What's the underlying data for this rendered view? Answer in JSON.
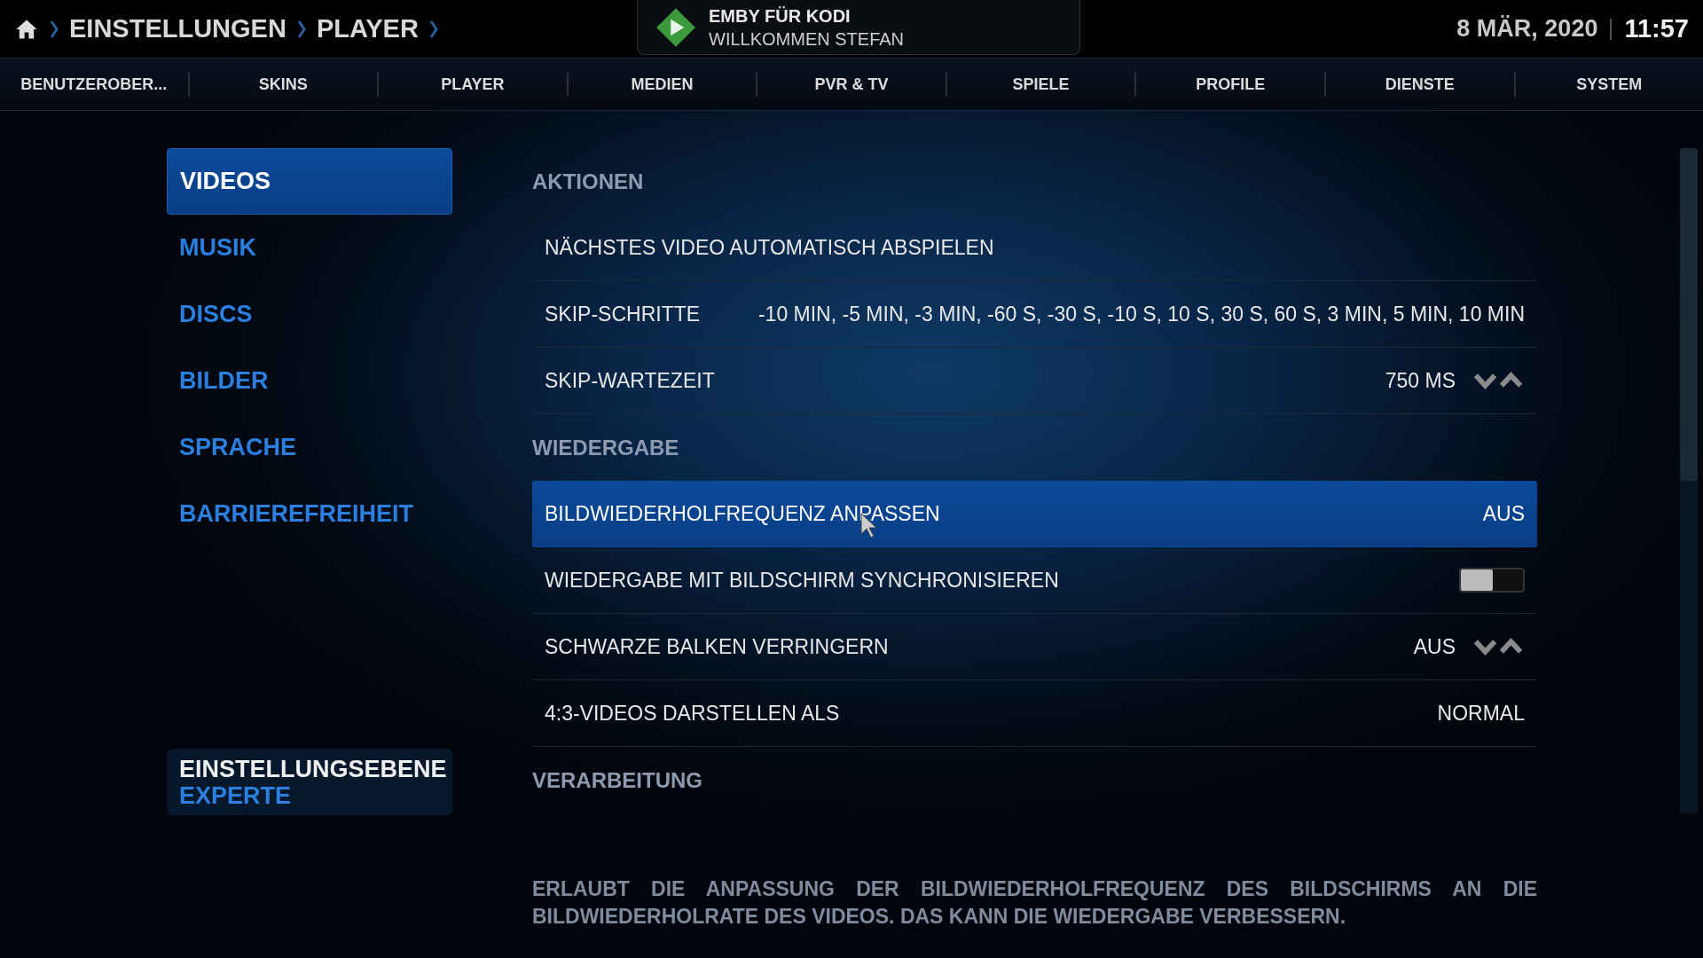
{
  "breadcrumb": [
    "EINSTELLUNGEN",
    "PLAYER"
  ],
  "header": {
    "title": "EMBY FÜR KODI",
    "subtitle": "WILLKOMMEN STEFAN"
  },
  "date": "8 MÄR, 2020",
  "time": "11:57",
  "tabs": [
    {
      "label": "BENUTZEROBER...",
      "selected": false
    },
    {
      "label": "SKINS",
      "selected": false
    },
    {
      "label": "PLAYER",
      "selected": false
    },
    {
      "label": "MEDIEN",
      "selected": false
    },
    {
      "label": "PVR & TV",
      "selected": false
    },
    {
      "label": "SPIELE",
      "selected": false
    },
    {
      "label": "PROFILE",
      "selected": false
    },
    {
      "label": "DIENSTE",
      "selected": false
    },
    {
      "label": "SYSTEM",
      "selected": false
    }
  ],
  "sidebar": {
    "items": [
      {
        "label": "VIDEOS",
        "selected": true
      },
      {
        "label": "MUSIK",
        "selected": false
      },
      {
        "label": "DISCS",
        "selected": false
      },
      {
        "label": "BILDER",
        "selected": false
      },
      {
        "label": "SPRACHE",
        "selected": false
      },
      {
        "label": "BARRIEREFREIHEIT",
        "selected": false
      }
    ],
    "level_button": {
      "label": "EINSTELLUNGSEBENE",
      "value": "EXPERTE"
    }
  },
  "settings": [
    {
      "kind": "section",
      "label": "AKTIONEN"
    },
    {
      "kind": "action",
      "label": "NÄCHSTES VIDEO AUTOMATISCH ABSPIELEN",
      "selected": false
    },
    {
      "kind": "list",
      "label": "SKIP-SCHRITTE",
      "value": "-10 MIN, -5 MIN, -3 MIN, -60 S, -30 S, -10 S, 10 S, 30 S, 60 S, 3 MIN, 5 MIN, 10 MIN",
      "selected": false
    },
    {
      "kind": "spinner",
      "label": "SKIP-WARTEZEIT",
      "value": "750 MS",
      "selected": false
    },
    {
      "kind": "section",
      "label": "WIEDERGABE"
    },
    {
      "kind": "list",
      "label": "BILDWIEDERHOLFREQUENZ ANPASSEN",
      "value": "AUS",
      "selected": true
    },
    {
      "kind": "toggle",
      "label": "WIEDERGABE MIT BILDSCHIRM SYNCHRONISIEREN",
      "on": false,
      "selected": false
    },
    {
      "kind": "spinner",
      "label": "SCHWARZE BALKEN VERRINGERN",
      "value": "AUS",
      "selected": false
    },
    {
      "kind": "list",
      "label": "4:3-VIDEOS DARSTELLEN ALS",
      "value": "NORMAL",
      "selected": false
    },
    {
      "kind": "section",
      "label": "VERARBEITUNG"
    }
  ],
  "description": "ERLAUBT DIE ANPASSUNG DER BILDWIEDERHOLFREQUENZ DES BILDSCHIRMS AN DIE BILDWIEDERHOLRATE DES VIDEOS. DAS KANN DIE WIEDERGABE VERBESSERN."
}
